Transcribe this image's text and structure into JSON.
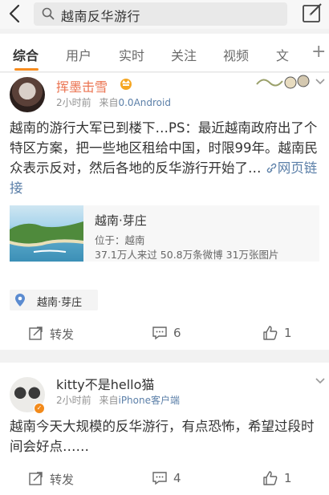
{
  "search": {
    "query": "越南反华游行"
  },
  "tabs": [
    {
      "label": "综合"
    },
    {
      "label": "用户"
    },
    {
      "label": "实时"
    },
    {
      "label": "关注"
    },
    {
      "label": "视频"
    },
    {
      "label": "文"
    }
  ],
  "tab_plus": "+",
  "accent_color": "#f78c1e",
  "posts": [
    {
      "author": "挥墨击雪",
      "time": "2小时前",
      "source_prefix": "来自",
      "source": "0.0Android",
      "text": "越南的游行大军已到楼下…PS：最近越南政府出了个特区方案，把一些地区租给中国，时限99年。越南民众表示反对，然后各地的反华游行开始了…",
      "link_label": "网页链接",
      "place": {
        "title": "越南·芽庄",
        "location": "位于：越南",
        "stats": "37.1万人来过 50.8万条微博 31万张图片"
      },
      "tag": "越南·芽庄",
      "actions": {
        "forward": "转发",
        "comments": "6",
        "likes": "1"
      }
    },
    {
      "author": "kitty不是hello猫",
      "time": "2小时前",
      "source_prefix": "来自",
      "source": "iPhone客户端",
      "text": "越南今天大规模的反华游行，有点恐怖，希望过段时间会好点……",
      "actions": {
        "forward": "转发",
        "comments": "4",
        "likes": "1"
      }
    }
  ]
}
